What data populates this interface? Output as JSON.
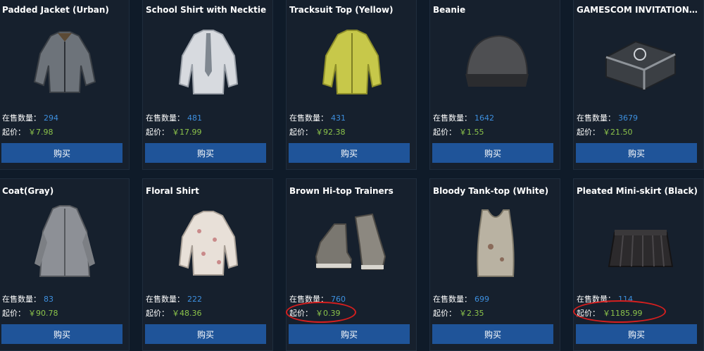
{
  "labels": {
    "stock": "在售数量：",
    "price": "起价：",
    "buy": "购买"
  },
  "items": [
    {
      "name": "Padded Jacket (Urban)",
      "stock": "294",
      "price": "￥7.98",
      "icon": "padded-jacket-icon"
    },
    {
      "name": "School Shirt with Necktie",
      "stock": "481",
      "price": "￥17.99",
      "icon": "school-shirt-icon"
    },
    {
      "name": "Tracksuit Top (Yellow)",
      "stock": "431",
      "price": "￥92.38",
      "icon": "tracksuit-top-icon"
    },
    {
      "name": "Beanie",
      "stock": "1642",
      "price": "￥1.55",
      "icon": "beanie-icon"
    },
    {
      "name": "GAMESCOM INVITATIONAL...",
      "stock": "3679",
      "price": "￥21.50",
      "icon": "crate-icon"
    },
    {
      "name": "Coat(Gray)",
      "stock": "83",
      "price": "￥90.78",
      "icon": "coat-icon"
    },
    {
      "name": "Floral Shirt",
      "stock": "222",
      "price": "￥48.36",
      "icon": "floral-shirt-icon"
    },
    {
      "name": "Brown Hi-top Trainers",
      "stock": "760",
      "price": "￥0.39",
      "icon": "trainers-icon"
    },
    {
      "name": "Bloody Tank-top (White)",
      "stock": "699",
      "price": "￥2.35",
      "icon": "tank-top-icon"
    },
    {
      "name": "Pleated Mini-skirt (Black)",
      "stock": "114",
      "price": "￥1185.99",
      "icon": "mini-skirt-icon"
    }
  ],
  "colors": {
    "background": "#0f1b29",
    "card": "#16202d",
    "button": "#1f5499",
    "stock_value": "#3d8fde",
    "price_value": "#8bc34a",
    "annotation": "#d61f1f"
  }
}
